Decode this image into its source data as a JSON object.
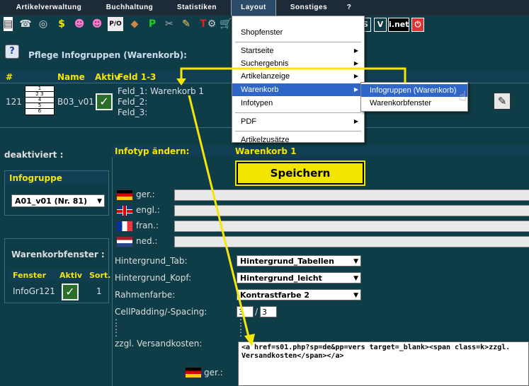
{
  "menubar": {
    "items": [
      "Artikelverwaltung",
      "Buchhaltung",
      "Statistiken",
      "Layout",
      "Sonstiges",
      "?"
    ]
  },
  "toolbar": {
    "icons": [
      "document-icon",
      "phone-icon",
      "binoculars-icon",
      "dollar-icon",
      "user-d-icon",
      "user-k-icon",
      "pio-icon",
      "box-icon",
      "p-icon",
      "tools-icon",
      "pencil-icon",
      "t-icon",
      "gear-icon",
      "cart-icon"
    ],
    "right_labels": [
      "S",
      "V",
      "i.net"
    ]
  },
  "page": {
    "title": "Pflege Infogruppen (Warenkorb):",
    "help_label": "?"
  },
  "table": {
    "headers": [
      "#",
      "Name",
      "Aktiv",
      "Feld 1-3"
    ],
    "row": {
      "num": "121",
      "thumb_rows": [
        "1",
        "2 3",
        "4",
        "5",
        "6"
      ],
      "name": "B03_v01",
      "feld1": "Feld_1: Warenkorb 1",
      "feld2": "Feld_2:",
      "feld3": "Feld_3:"
    }
  },
  "left": {
    "deaktiviert": "deaktiviert :",
    "infogruppe_head": "Infogruppe",
    "infogruppe_value": "A01_v01 (Nr. 81)",
    "warenkorbfenster_title": "Warenkorbfenster :",
    "wk_headers": [
      "Fenster",
      "Aktiv",
      "Sort."
    ],
    "wk_row": {
      "fenster": "InfoGr121",
      "sort": "1"
    }
  },
  "form": {
    "head_left": "Infotyp ändern:",
    "head_right": "Warenkorb 1",
    "save_label": "Speichern",
    "langs": [
      "ger.:",
      "engl.:",
      "fran.:",
      "ned.:"
    ],
    "hintergrund_tab_label": "Hintergrund_Tab:",
    "hintergrund_tab_value": "Hintergrund_Tabellen",
    "hintergrund_kopf_label": "Hintergrund_Kopf:",
    "hintergrund_kopf_value": "Hintergrund_leicht",
    "rahmenfarbe_label": "Rahmenfarbe:",
    "rahmenfarbe_value": "Kontrastfarbe 2",
    "cellpadding_label": "CellPadding/-Spacing:",
    "cellpadding_value": "3",
    "cellspacing_value": "3",
    "dots": ":",
    "versand_label": "zzgl. Versandkosten:",
    "versand_value": "<a href=s01.php?sp=de&pp=vers target=_blank><span class=k>zzgl. Versandkosten</span></a>",
    "ger_bottom": "ger.:"
  },
  "layout_menu": {
    "items": [
      "Shopfenster",
      "Startseite",
      "Suchergebnis",
      "Artikelanzeige",
      "Warenkorb",
      "Infotypen",
      "PDF",
      "Artikelzusätze"
    ]
  },
  "sub_menu": {
    "items": [
      "Infogruppen (Warenkorb)",
      "Warenkorbfenster"
    ]
  },
  "colors": {
    "accent": "#f4e50a",
    "background": "#0f3d47",
    "highlight": "#2f66c8"
  }
}
